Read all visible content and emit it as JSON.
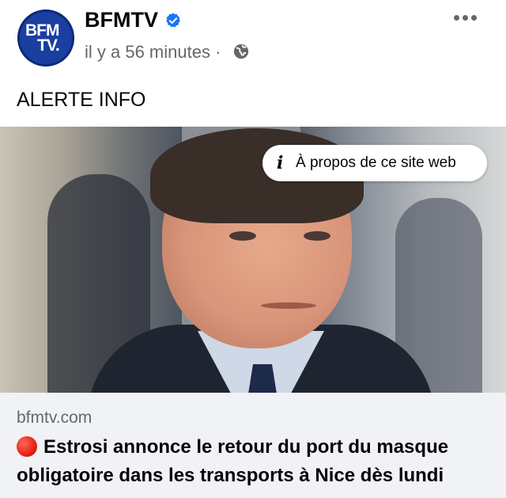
{
  "header": {
    "page_name": "BFMTV",
    "timestamp": "il y a 56 minutes · ",
    "logo_line1": "BFM",
    "logo_line2": "TV.",
    "verified": true
  },
  "post": {
    "text": "ALERTE INFO"
  },
  "image": {
    "about_site_label": "À propos de ce site web"
  },
  "link": {
    "domain": "bfmtv.com",
    "headline": "Estrosi annonce le retour du port du masque obligatoire dans les transports à Nice dès lundi"
  },
  "icons": {
    "verified": "verified-badge-icon",
    "globe": "globe-icon",
    "more": "more-options-icon",
    "info": "info-icon",
    "red_circle": "red-circle-emoji"
  },
  "colors": {
    "verified_blue": "#1877f2",
    "secondary_text": "#65676b",
    "link_box_bg": "#f0f2f5",
    "logo_blue": "#1a3fa0"
  }
}
